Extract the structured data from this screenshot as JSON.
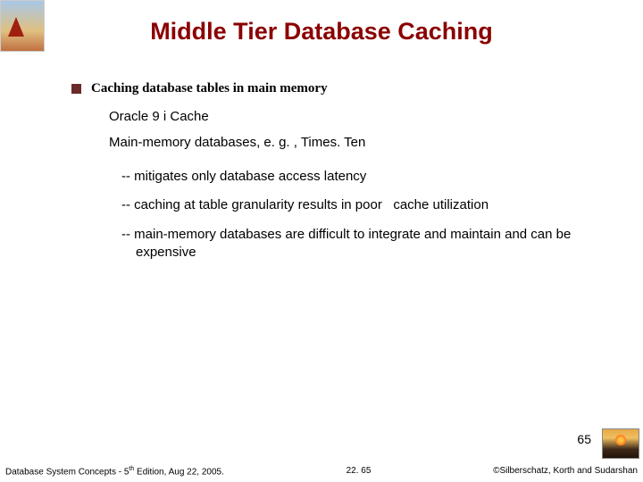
{
  "title": "Middle Tier Database Caching",
  "lead": "Caching database tables in main memory",
  "sub_items": [
    "Oracle 9 i Cache",
    "Main-memory databases, e. g. , Times. Ten"
  ],
  "dash_items": [
    "-- mitigates only database access latency",
    "-- caching at table granularity results in poor   cache utilization",
    "-- main-memory databases are difficult to integrate and maintain and can be expensive"
  ],
  "page_num": "65",
  "footer": {
    "left_pre": "Database System Concepts - 5",
    "left_sup": "th",
    "left_post": " Edition, Aug 22, 2005.",
    "center": "22. 65",
    "right": "©Silberschatz, Korth and Sudarshan"
  }
}
